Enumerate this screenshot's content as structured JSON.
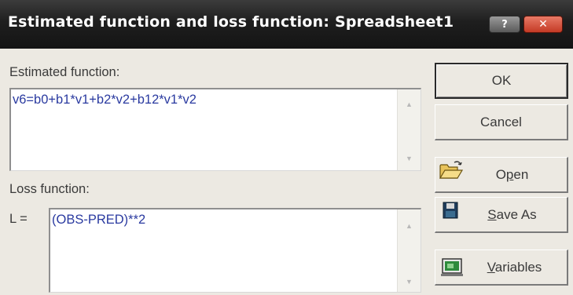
{
  "window": {
    "title": "Estimated function and loss function: Spreadsheet1",
    "help_label": "?",
    "close_label": "✕"
  },
  "estimated_function": {
    "label": "Estimated function:",
    "value": "v6=b0+b1*v1+b2*v2+b12*v1*v2"
  },
  "loss_function": {
    "label": "Loss function:",
    "prefix": "L =",
    "value": "(OBS-PRED)**2"
  },
  "buttons": {
    "ok": "OK",
    "cancel": "Cancel",
    "open": {
      "pre": "O",
      "mnemonic": "p",
      "post": "en",
      "icon": "folder-open-icon"
    },
    "save_as": {
      "pre": "",
      "mnemonic": "S",
      "post": "ave As",
      "icon": "floppy-disk-icon"
    },
    "variables": {
      "pre": "",
      "mnemonic": "V",
      "post": "ariables",
      "icon": "variables-icon"
    }
  },
  "scroll": {
    "up": "▲",
    "down": "▼"
  },
  "colors": {
    "title_bar": "#1e1e1e",
    "dialog_background": "#ece9e2",
    "formula_text": "#2a3aa0",
    "close_button": "#c43a25"
  }
}
